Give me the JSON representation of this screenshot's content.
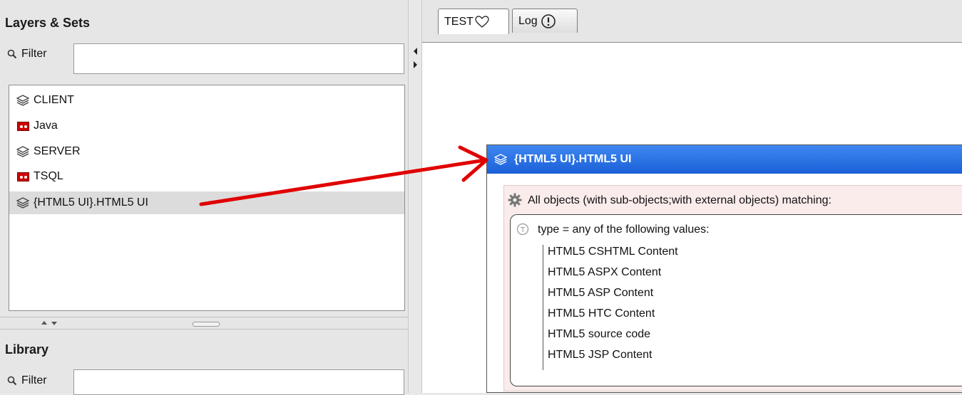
{
  "layers_panel": {
    "title": "Layers & Sets",
    "filter_label": "Filter",
    "filter_value": "",
    "items": [
      {
        "label": "CLIENT",
        "icon": "layers-icon"
      },
      {
        "label": "Java",
        "icon": "table-icon"
      },
      {
        "label": "SERVER",
        "icon": "layers-icon"
      },
      {
        "label": "TSQL",
        "icon": "table-icon"
      },
      {
        "label": "{HTML5 UI}.HTML5 UI",
        "icon": "layers-icon",
        "selected": true
      }
    ]
  },
  "library_panel": {
    "title": "Library",
    "filter_label": "Filter",
    "filter_value": ""
  },
  "tabs": [
    {
      "label": "TEST",
      "icon": "heart-outline-icon",
      "active": true
    },
    {
      "label": "Log",
      "icon": "exclamation-circle-icon",
      "active": false
    }
  ],
  "set_view": {
    "header": "{HTML5 UI}.HTML5 UI",
    "condition": "All objects (with sub-objects;with external objects) matching:",
    "rule": "type = any of the following values:",
    "values": [
      "HTML5 CSHTML Content",
      "HTML5 ASPX Content",
      "HTML5 ASP Content",
      "HTML5 HTC Content",
      "HTML5 source code",
      "HTML5 JSP Content"
    ]
  },
  "colors": {
    "header_blue": "#1a5fd8",
    "arrow_red": "#e00000",
    "condition_bg": "#fbecec"
  }
}
